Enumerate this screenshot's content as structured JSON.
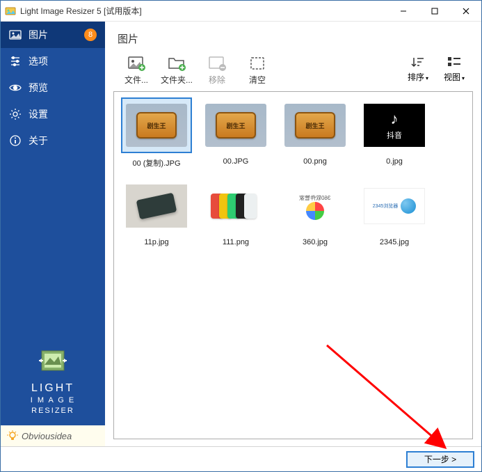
{
  "window": {
    "title": "Light Image Resizer 5  [试用版本]"
  },
  "sidebar": {
    "items": [
      {
        "label": "图片",
        "badge": "8",
        "icon": "picture"
      },
      {
        "label": "选项",
        "icon": "sliders"
      },
      {
        "label": "预览",
        "icon": "eye"
      },
      {
        "label": "设置",
        "icon": "gear"
      },
      {
        "label": "关于",
        "icon": "info"
      }
    ],
    "product_line1": "LIGHT",
    "product_line2": "I M A G E",
    "product_line3": "RESIZER",
    "brand": "Obviousidea"
  },
  "main": {
    "title": "图片"
  },
  "toolbar": {
    "file": "文件...",
    "folder": "文件夹...",
    "remove": "移除",
    "clear": "清空",
    "sort": "排序",
    "view": "视图"
  },
  "files": [
    {
      "name": "00 (复制).JPG",
      "thumb": "badge",
      "selected": true
    },
    {
      "name": "00.JPG",
      "thumb": "badge"
    },
    {
      "name": "00.png",
      "thumb": "badge"
    },
    {
      "name": "0.jpg",
      "thumb": "douyin",
      "douyin_text": "抖音"
    },
    {
      "name": "11p.jpg",
      "thumb": "phone"
    },
    {
      "name": "111.png",
      "thumb": "colors"
    },
    {
      "name": "360.jpg",
      "thumb": "360",
      "text360": "360软件管家"
    },
    {
      "name": "2345.jpg",
      "thumb": "2345",
      "text2345": "2345浏览器"
    }
  ],
  "footer": {
    "next": "下一步 >"
  }
}
